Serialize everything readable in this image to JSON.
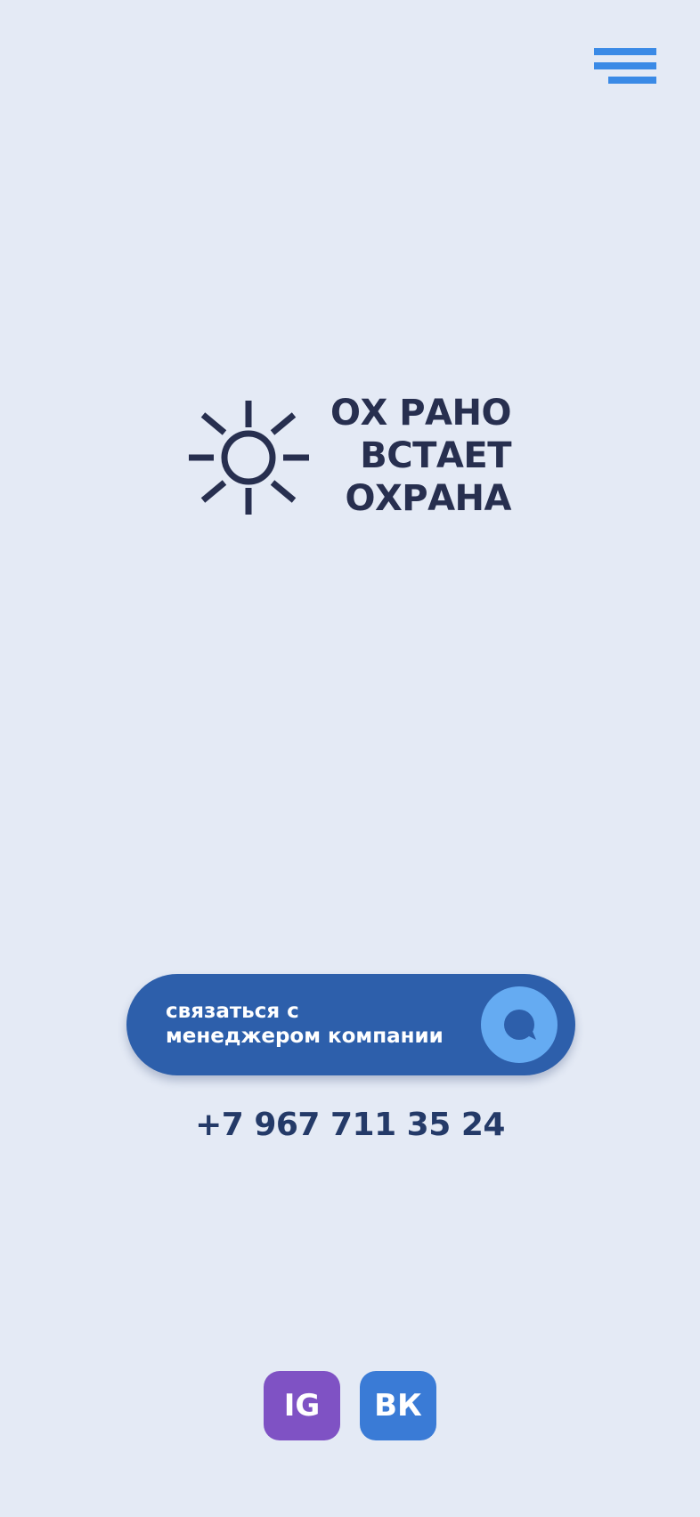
{
  "header": {
    "menu_icon": "hamburger-menu-icon"
  },
  "logo": {
    "icon": "sun-icon",
    "lines": [
      "ОХ РАНО",
      "ВСТАЕТ",
      "ОХРАНА"
    ]
  },
  "contact": {
    "label_line1": "связаться с",
    "label_line2": "менеджером компании",
    "icon": "chat-bubble-icon"
  },
  "phone": "+7 967 711 35 24",
  "social": {
    "instagram_label": "IG",
    "vk_label": "ВК"
  },
  "colors": {
    "background": "#e4eaf5",
    "accent": "#3a8ae6",
    "button": "#2d5fab",
    "button_icon_bg": "#65abf2",
    "text_dark": "#272f4f",
    "instagram": "#7f52c4",
    "vk": "#3a7bd6"
  }
}
